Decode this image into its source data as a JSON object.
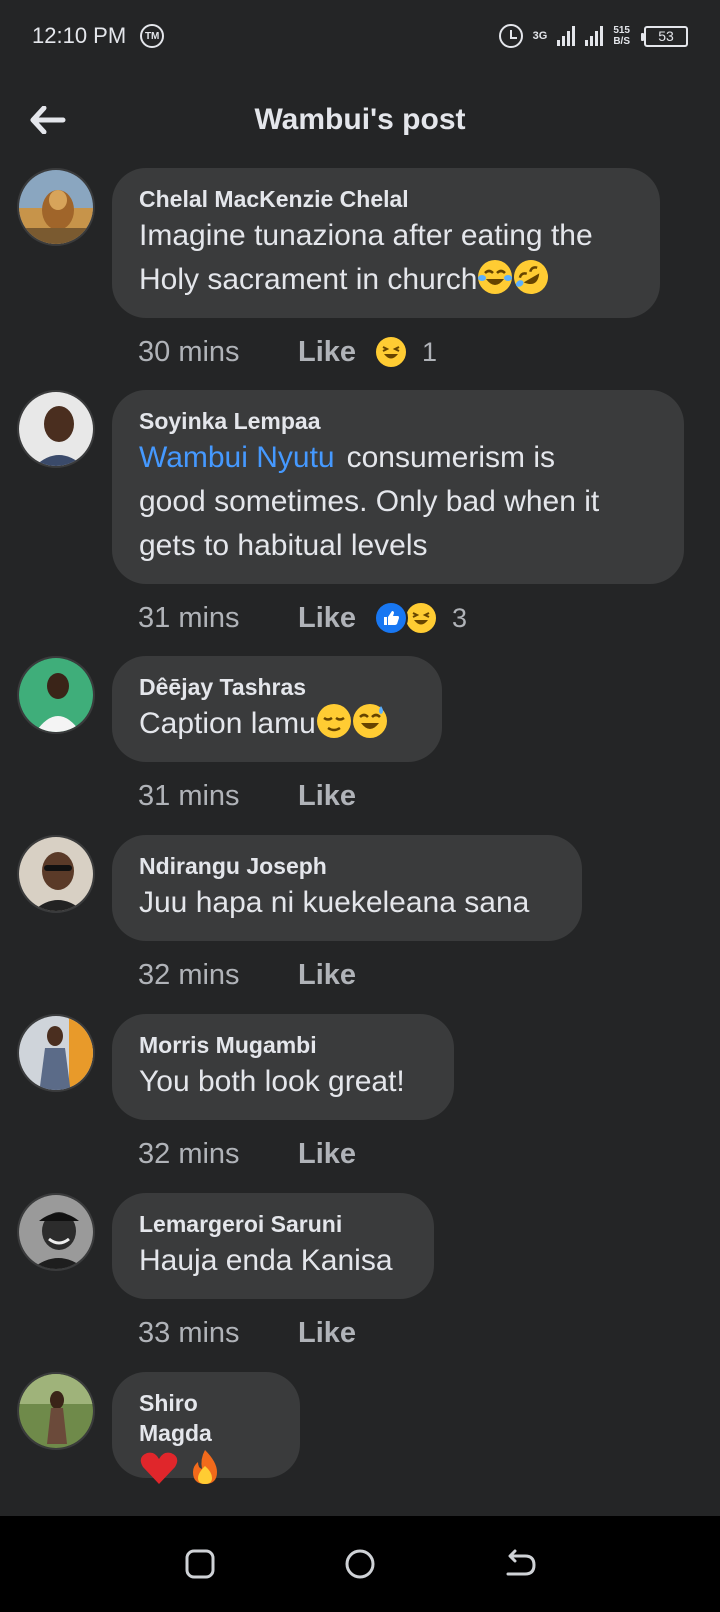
{
  "status_bar": {
    "time": "12:10 PM",
    "tm_badge": "TM",
    "network_type": "3G",
    "speed_value": "515",
    "speed_unit": "B/S",
    "battery": "53"
  },
  "header": {
    "title": "Wambui's post"
  },
  "like_label": "Like",
  "comments": [
    {
      "author": "Chelal MacKenzie Chelal",
      "text": "Imagine tunaziona after eating the Holy sacrament in church",
      "emojis": [
        "joy-emoji",
        "rofl-emoji"
      ],
      "time": "30 mins",
      "reactions": [
        "laughing-reaction"
      ],
      "reaction_count": "1"
    },
    {
      "author": "Soyinka Lempaa",
      "mention": "Wambui Nyutu",
      "text_line1": "consumerism is",
      "text_line2": "good sometimes. Only bad when it",
      "text_line3": "gets to habitual levels",
      "time": "31 mins",
      "reactions": [
        "like-reaction",
        "laughing-reaction"
      ],
      "reaction_count": "3"
    },
    {
      "author": "Dêējay Tashras",
      "text": "Caption lamu",
      "emojis": [
        "relieved-emoji",
        "sweat-smile-emoji"
      ],
      "time": "31 mins"
    },
    {
      "author": "Ndirangu Joseph",
      "text": "Juu hapa ni kuekeleana sana",
      "time": "32 mins"
    },
    {
      "author": "Morris Mugambi",
      "text": "You both look great!",
      "time": "32 mins"
    },
    {
      "author": "Lemargeroi Saruni",
      "text": "Hauja enda Kanisa",
      "time": "33 mins"
    },
    {
      "author": "Shiro Magda",
      "emojis": [
        "heart-emoji",
        "fire-emoji"
      ]
    }
  ],
  "colors": {
    "background": "#242526",
    "bubble": "#3a3b3c",
    "mention": "#4599ff",
    "secondary_text": "#b0b3b8"
  }
}
